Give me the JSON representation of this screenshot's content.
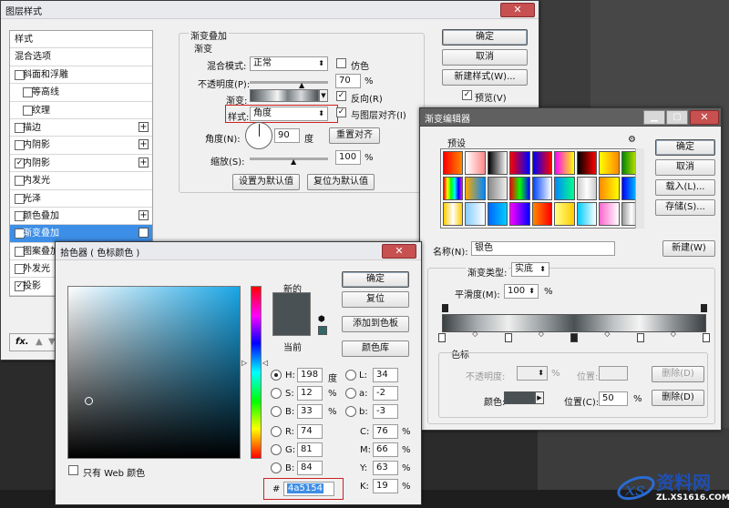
{
  "background_panel": {
    "title": ""
  },
  "layer_style": {
    "title": "图层样式",
    "sidebar": [
      {
        "label": "样式",
        "check": false,
        "plus": false,
        "sub": false,
        "noCheck": true
      },
      {
        "label": "混合选项",
        "check": false,
        "plus": false,
        "sub": false,
        "noCheck": true
      },
      {
        "label": "斜面和浮雕",
        "check": false,
        "plus": false,
        "sub": false
      },
      {
        "label": "等高线",
        "check": false,
        "plus": false,
        "sub": true
      },
      {
        "label": "纹理",
        "check": false,
        "plus": false,
        "sub": true
      },
      {
        "label": "描边",
        "check": false,
        "plus": true,
        "sub": false
      },
      {
        "label": "内阴影",
        "check": false,
        "plus": true,
        "sub": false
      },
      {
        "label": "内阴影",
        "check": true,
        "plus": true,
        "sub": false
      },
      {
        "label": "内发光",
        "check": false,
        "plus": false,
        "sub": false
      },
      {
        "label": "光泽",
        "check": false,
        "plus": false,
        "sub": false
      },
      {
        "label": "颜色叠加",
        "check": false,
        "plus": true,
        "sub": false
      },
      {
        "label": "渐变叠加",
        "check": true,
        "plus": true,
        "sub": false,
        "active": true
      },
      {
        "label": "图案叠加",
        "check": false,
        "plus": false,
        "sub": false
      },
      {
        "label": "外发光",
        "check": false,
        "plus": false,
        "sub": false
      },
      {
        "label": "投影",
        "check": true,
        "plus": true,
        "sub": false
      }
    ],
    "fx": "fx.",
    "section_title": "渐变叠加",
    "group_title": "渐变",
    "blend_mode_label": "混合模式:",
    "blend_mode_value": "正常",
    "dither_label": "仿色",
    "opacity_label": "不透明度(P):",
    "opacity_value": "70",
    "percent": "%",
    "gradient_label": "渐变:",
    "reverse_label": "反向(R)",
    "style_label": "样式:",
    "style_value": "角度",
    "align_label": "与图层对齐(I)",
    "angle_label": "角度(N):",
    "angle_value": "90",
    "degree": "度",
    "reset_align": "重置对齐",
    "scale_label": "缩放(S):",
    "scale_value": "100",
    "set_default": "设置为默认值",
    "reset_default": "复位为默认值",
    "ok": "确定",
    "cancel": "取消",
    "new_style": "新建样式(W)...",
    "preview": "预览(V)"
  },
  "gradient_editor": {
    "title": "渐变编辑器",
    "presets_label": "预设",
    "ok": "确定",
    "cancel": "取消",
    "load": "载入(L)...",
    "save": "存储(S)...",
    "name_label": "名称(N):",
    "name_value": "银色",
    "new": "新建(W)",
    "type_label": "渐变类型:",
    "type_value": "实底",
    "smooth_label": "平滑度(M):",
    "smooth_value": "100",
    "percent": "%",
    "stops_title": "色标",
    "opacity_label": "不透明度:",
    "opacity_pct": "%",
    "location_label": "位置:",
    "delete": "删除(D)",
    "color_label": "颜色:",
    "color_location_label": "位置(C):",
    "color_location_value": "50",
    "color_delete": "删除(D)",
    "stop_color": "#4a5154"
  },
  "color_picker": {
    "title": "拾色器 ( 色标颜色 )",
    "new_label": "新的",
    "current_label": "当前",
    "ok": "确定",
    "reset": "复位",
    "add_swatch": "添加到色板",
    "color_lib": "颜色库",
    "H_label": "H:",
    "H": "198",
    "H_unit": "度",
    "S_label": "S:",
    "S": "12",
    "S_unit": "%",
    "B_label": "B:",
    "B": "33",
    "B_unit": "%",
    "R_label": "R:",
    "R": "74",
    "G_label": "G:",
    "G": "81",
    "Bb_label": "B:",
    "Bb": "84",
    "L_label": "L:",
    "L": "34",
    "a_label": "a:",
    "a": "-2",
    "b_label": "b:",
    "b": "-3",
    "C_label": "C:",
    "C": "76",
    "M_label": "M:",
    "M": "66",
    "Y_label": "Y:",
    "Y": "63",
    "K_label": "K:",
    "K": "19",
    "pct": "%",
    "hex_label": "#",
    "hex": "4a5154",
    "web_only": "只有 Web 颜色",
    "new_color": "#4a5154",
    "current_color": "#4a5154"
  },
  "watermark": {
    "name": "资料网",
    "url": "ZL.XS1616.COM"
  }
}
